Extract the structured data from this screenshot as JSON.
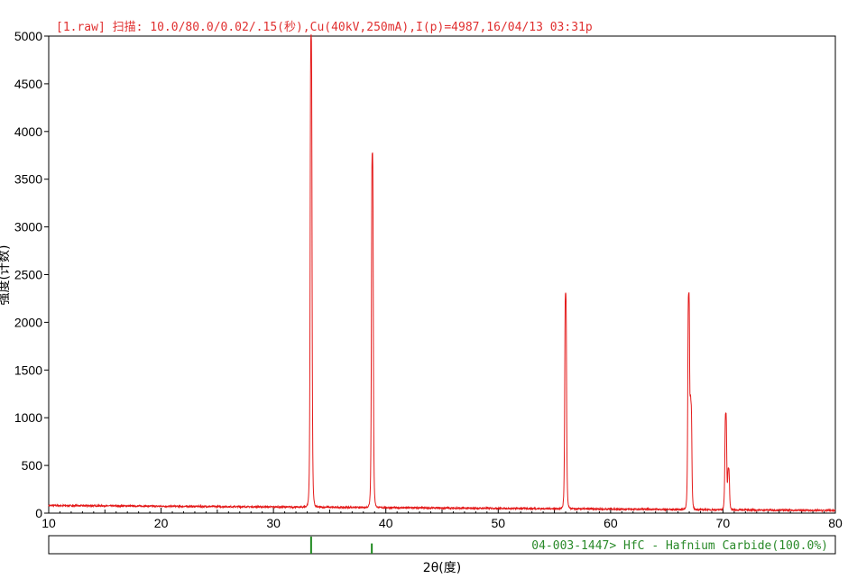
{
  "header": {
    "scan_info": "[1.raw] 扫描: 10.0/80.0/0.02/.15(秒),Cu(40kV,250mA),I(p)=4987,16/04/13 03:31p"
  },
  "colors": {
    "pattern": "#e41a1a",
    "reference": "#1f8a1f",
    "header": "#e03030"
  },
  "reference": {
    "label": "04-003-1447> HfC - Hafnium Carbide(100.0%)",
    "sticks": [
      {
        "x": 33.35,
        "rel": 1.0
      },
      {
        "x": 38.75,
        "rel": 0.6
      }
    ]
  },
  "chart_data": {
    "type": "line",
    "xlabel": "2θ(度)",
    "ylabel": "强度(计数)",
    "xlim": [
      10,
      80
    ],
    "ylim": [
      0,
      5000
    ],
    "xticks": [
      10,
      20,
      30,
      40,
      50,
      60,
      70,
      80
    ],
    "yticks": [
      0,
      500,
      1000,
      1500,
      2000,
      2500,
      3000,
      3500,
      4000,
      4500,
      5000
    ],
    "grid": false,
    "background": {
      "start_x": 10,
      "start_y": 80,
      "end_x": 80,
      "end_y": 28
    },
    "peaks": [
      {
        "x": 33.35,
        "y": 4987
      },
      {
        "x": 38.8,
        "y": 3760
      },
      {
        "x": 56.0,
        "y": 2300
      },
      {
        "x": 66.95,
        "y": 2265
      },
      {
        "x": 67.15,
        "y": 1090
      },
      {
        "x": 70.25,
        "y": 1045
      },
      {
        "x": 70.5,
        "y": 460
      }
    ]
  }
}
